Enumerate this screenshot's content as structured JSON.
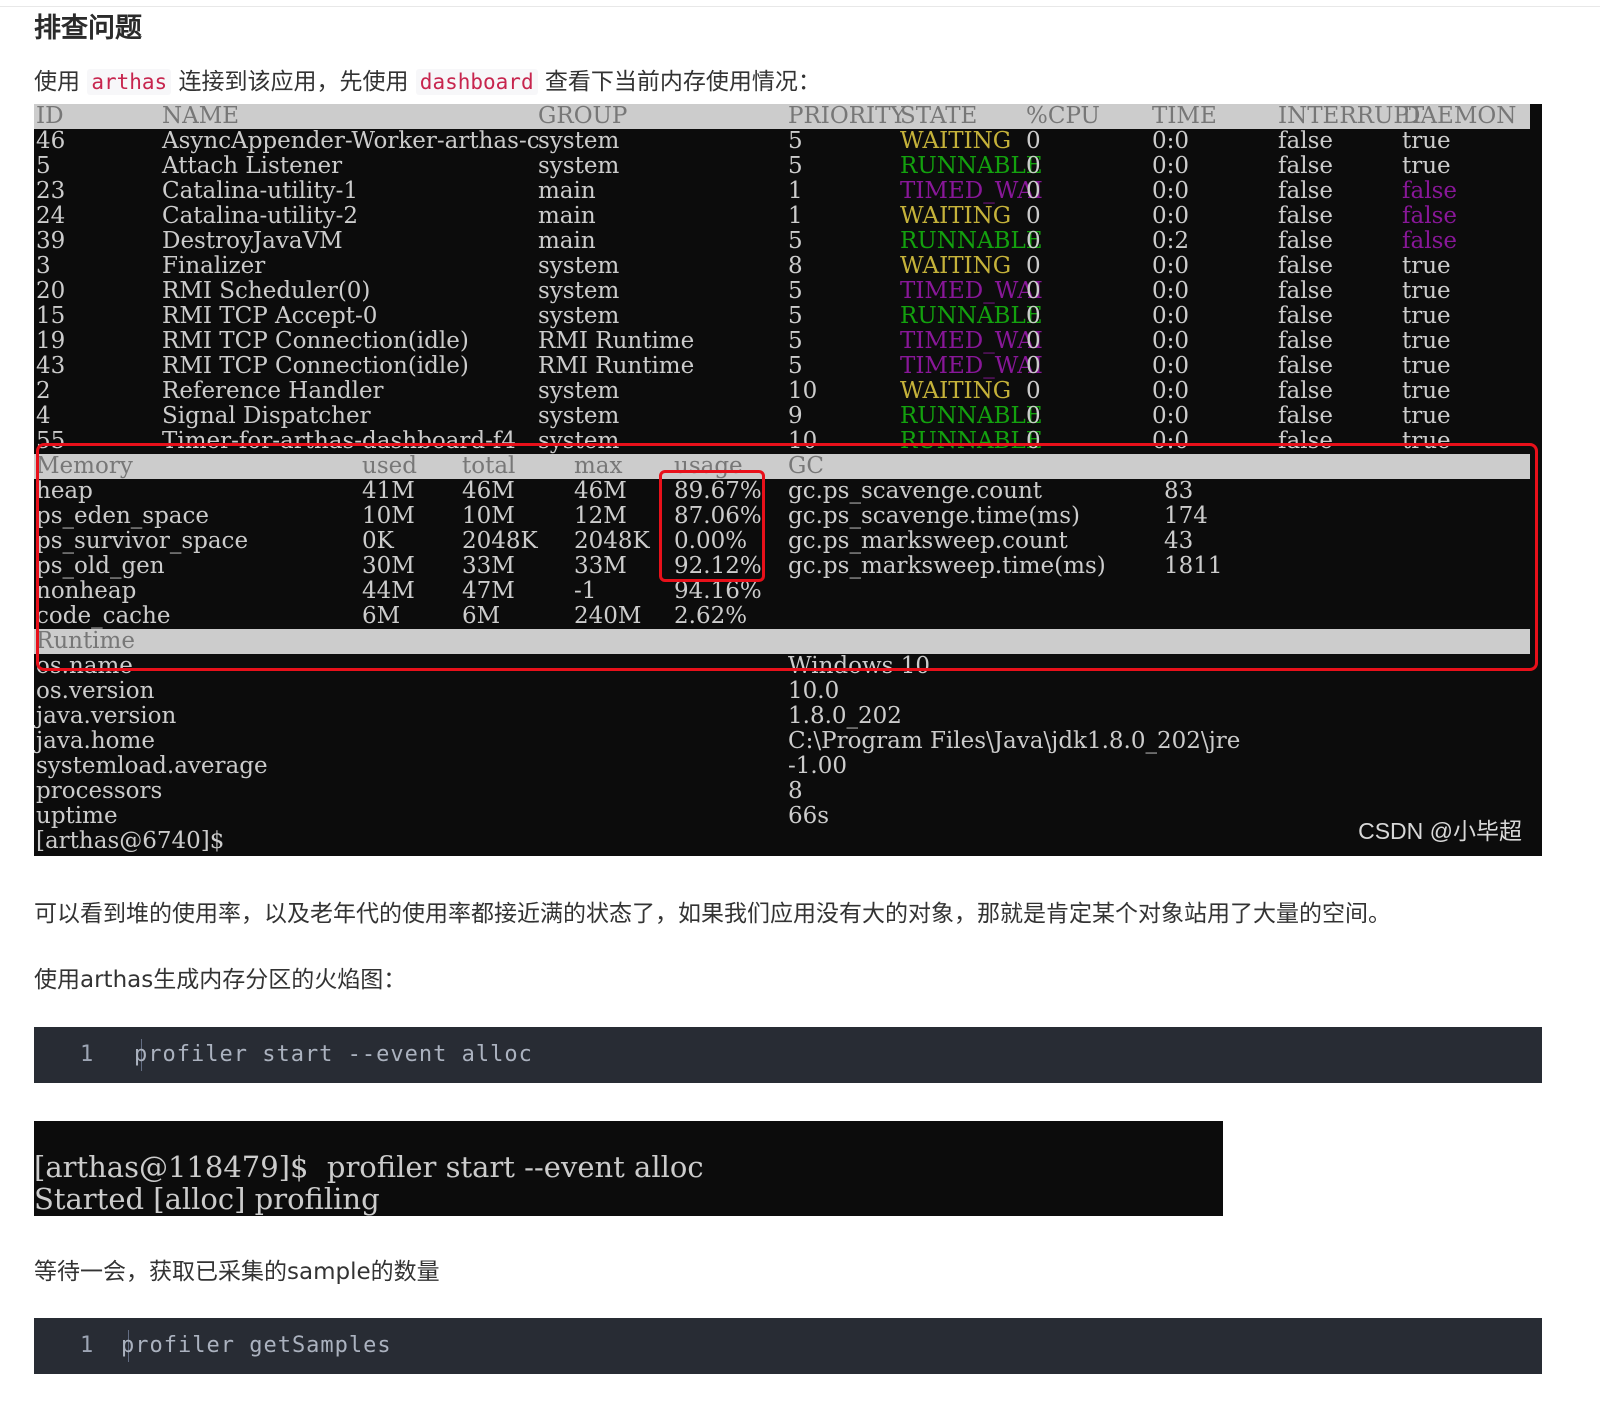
{
  "section_title": "排查问题",
  "intro": {
    "before": "使用 ",
    "code1": "arthas",
    "middle": " 连接到该应用，先使用 ",
    "code2": "dashboard",
    "after": " 查看下当前内存使用情况："
  },
  "dashboard": {
    "thread_headers": [
      "ID",
      "NAME",
      "GROUP",
      "PRIORITY",
      "STATE",
      "%CPU",
      "TIME",
      "INTERRUPT",
      "DAEMON"
    ],
    "threads": [
      {
        "id": "46",
        "name": "AsyncAppender-Worker-arthas-c",
        "group": "system",
        "priority": "5",
        "state": "WAITING",
        "state_color": "#c5b23a",
        "cpu": "0",
        "time": "0:0",
        "interrupt": "false",
        "daemon": "true",
        "daemon_color": "#cccccc"
      },
      {
        "id": "5",
        "name": "Attach Listener",
        "group": "system",
        "priority": "5",
        "state": "RUNNABLE",
        "state_color": "#13a10e",
        "cpu": "0",
        "time": "0:0",
        "interrupt": "false",
        "daemon": "true",
        "daemon_color": "#cccccc"
      },
      {
        "id": "23",
        "name": "Catalina-utility-1",
        "group": "main",
        "priority": "1",
        "state": "TIMED_WAI",
        "state_color": "#881798",
        "cpu": "0",
        "time": "0:0",
        "interrupt": "false",
        "daemon": "false",
        "daemon_color": "#881798"
      },
      {
        "id": "24",
        "name": "Catalina-utility-2",
        "group": "main",
        "priority": "1",
        "state": "WAITING",
        "state_color": "#c5b23a",
        "cpu": "0",
        "time": "0:0",
        "interrupt": "false",
        "daemon": "false",
        "daemon_color": "#881798"
      },
      {
        "id": "39",
        "name": "DestroyJavaVM",
        "group": "main",
        "priority": "5",
        "state": "RUNNABLE",
        "state_color": "#13a10e",
        "cpu": "0",
        "time": "0:2",
        "interrupt": "false",
        "daemon": "false",
        "daemon_color": "#881798"
      },
      {
        "id": "3",
        "name": "Finalizer",
        "group": "system",
        "priority": "8",
        "state": "WAITING",
        "state_color": "#c5b23a",
        "cpu": "0",
        "time": "0:0",
        "interrupt": "false",
        "daemon": "true",
        "daemon_color": "#cccccc"
      },
      {
        "id": "20",
        "name": "RMI Scheduler(0)",
        "group": "system",
        "priority": "5",
        "state": "TIMED_WAI",
        "state_color": "#881798",
        "cpu": "0",
        "time": "0:0",
        "interrupt": "false",
        "daemon": "true",
        "daemon_color": "#cccccc"
      },
      {
        "id": "15",
        "name": "RMI TCP Accept-0",
        "group": "system",
        "priority": "5",
        "state": "RUNNABLE",
        "state_color": "#13a10e",
        "cpu": "0",
        "time": "0:0",
        "interrupt": "false",
        "daemon": "true",
        "daemon_color": "#cccccc"
      },
      {
        "id": "19",
        "name": "RMI TCP Connection(idle)",
        "group": "RMI Runtime",
        "priority": "5",
        "state": "TIMED_WAI",
        "state_color": "#881798",
        "cpu": "0",
        "time": "0:0",
        "interrupt": "false",
        "daemon": "true",
        "daemon_color": "#cccccc"
      },
      {
        "id": "43",
        "name": "RMI TCP Connection(idle)",
        "group": "RMI Runtime",
        "priority": "5",
        "state": "TIMED_WAI",
        "state_color": "#881798",
        "cpu": "0",
        "time": "0:0",
        "interrupt": "false",
        "daemon": "true",
        "daemon_color": "#cccccc"
      },
      {
        "id": "2",
        "name": "Reference Handler",
        "group": "system",
        "priority": "10",
        "state": "WAITING",
        "state_color": "#c5b23a",
        "cpu": "0",
        "time": "0:0",
        "interrupt": "false",
        "daemon": "true",
        "daemon_color": "#cccccc"
      },
      {
        "id": "4",
        "name": "Signal Dispatcher",
        "group": "system",
        "priority": "9",
        "state": "RUNNABLE",
        "state_color": "#13a10e",
        "cpu": "0",
        "time": "0:0",
        "interrupt": "false",
        "daemon": "true",
        "daemon_color": "#cccccc"
      },
      {
        "id": "55",
        "name": "Timer-for-arthas-dashboard-f4",
        "group": "system",
        "priority": "10",
        "state": "RUNNABLE",
        "state_color": "#13a10e",
        "cpu": "0",
        "time": "0:0",
        "interrupt": "false",
        "daemon": "true",
        "daemon_color": "#cccccc"
      }
    ],
    "memory_headers": [
      "Memory",
      "used",
      "total",
      "max",
      "usage",
      "GC"
    ],
    "memory": [
      {
        "name": "heap",
        "used": "41M",
        "total": "46M",
        "max": "46M",
        "usage": "89.67%",
        "gc_name": "gc.ps_scavenge.count",
        "gc_value": "83"
      },
      {
        "name": "ps_eden_space",
        "used": "10M",
        "total": "10M",
        "max": "12M",
        "usage": "87.06%",
        "gc_name": "gc.ps_scavenge.time(ms)",
        "gc_value": "174"
      },
      {
        "name": "ps_survivor_space",
        "used": "0K",
        "total": "2048K",
        "max": "2048K",
        "usage": "0.00%",
        "gc_name": "gc.ps_marksweep.count",
        "gc_value": "43"
      },
      {
        "name": "ps_old_gen",
        "used": "30M",
        "total": "33M",
        "max": "33M",
        "usage": "92.12%",
        "gc_name": "gc.ps_marksweep.time(ms)",
        "gc_value": "1811"
      },
      {
        "name": "nonheap",
        "used": "44M",
        "total": "47M",
        "max": "-1",
        "usage": "94.16%",
        "gc_name": "",
        "gc_value": ""
      },
      {
        "name": "code_cache",
        "used": "6M",
        "total": "6M",
        "max": "240M",
        "usage": "2.62%",
        "gc_name": "",
        "gc_value": ""
      }
    ],
    "runtime_header": "Runtime",
    "runtime": [
      {
        "key": "os.name",
        "value": "Windows 10"
      },
      {
        "key": "os.version",
        "value": "10.0"
      },
      {
        "key": "java.version",
        "value": "1.8.0_202"
      },
      {
        "key": "java.home",
        "value": "C:\\Program Files\\Java\\jdk1.8.0_202\\jre"
      },
      {
        "key": "systemload.average",
        "value": "-1.00"
      },
      {
        "key": "processors",
        "value": "8"
      },
      {
        "key": "uptime",
        "value": "66s"
      }
    ],
    "prompt": "[arthas@6740]$",
    "watermark": "CSDN @小毕超"
  },
  "para_heap": "可以看到堆的使用率，以及老年代的使用率都接近满的状态了，如果我们应用没有大的对象，那就是肯定某个对象站用了大量的空间。",
  "para_flame": "使用arthas生成内存分区的火焰图：",
  "code_block_1": {
    "line_no": "1",
    "code": "profiler start --event alloc"
  },
  "terminal_2": {
    "line1": "[arthas@118479]$  profiler start --event alloc",
    "line2": "Started [alloc] profiling"
  },
  "para_wait": "等待一会，获取已采集的sample的数量",
  "code_block_2": {
    "line_no": "1",
    "code": "profiler getSamples"
  }
}
